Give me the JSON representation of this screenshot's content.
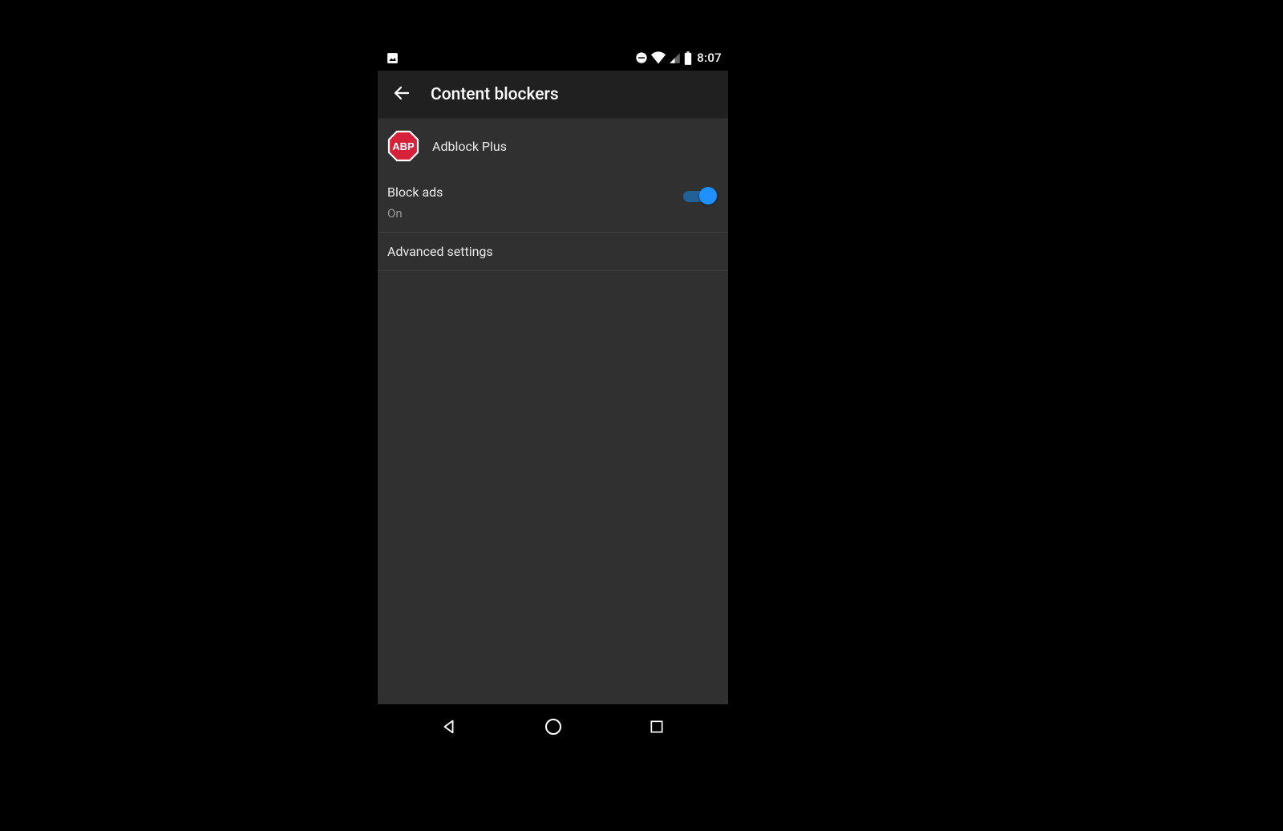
{
  "statusbar": {
    "time": "8:07"
  },
  "appbar": {
    "title": "Content blockers"
  },
  "blocker": {
    "name": "Adblock Plus",
    "icon_text": "ABP"
  },
  "settings": {
    "block_ads": {
      "label": "Block ads",
      "status": "On",
      "value": true
    },
    "advanced": {
      "label": "Advanced settings"
    }
  },
  "colors": {
    "accent": "#1e90ff",
    "abp_red": "#d6213a"
  }
}
